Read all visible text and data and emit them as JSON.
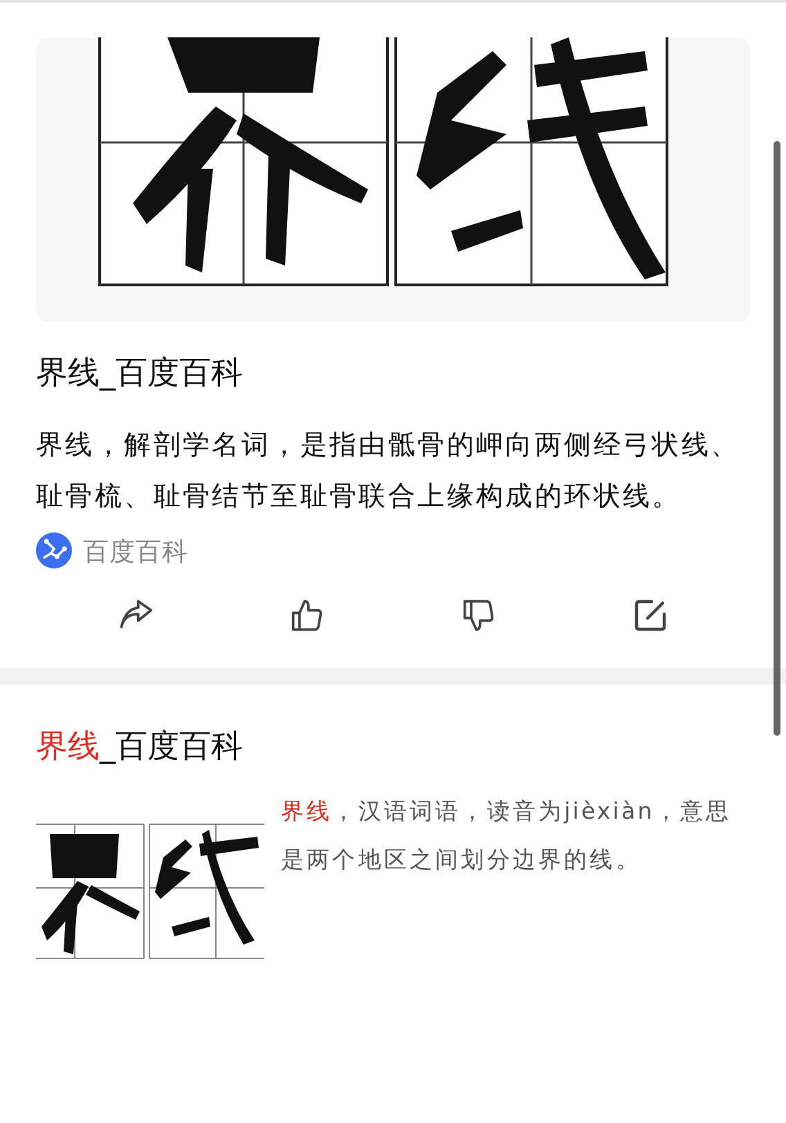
{
  "results": [
    {
      "kind": "hero",
      "title": {
        "rest": "界线_百度百科"
      },
      "summary": {
        "rest": "界线，解剖学名词，是指由骶骨的岬向两侧经弓状线、耻骨梳、耻骨结节至耻骨联合上缘构成的环状线。"
      },
      "source": "百度百科"
    },
    {
      "kind": "side",
      "title": {
        "highlight": "界线",
        "rest": "_百度百科"
      },
      "summary": {
        "highlight": "界线",
        "rest": "，汉语词语，读音为jièxiàn，意思是两个地区之间划分边界的线。"
      }
    }
  ]
}
